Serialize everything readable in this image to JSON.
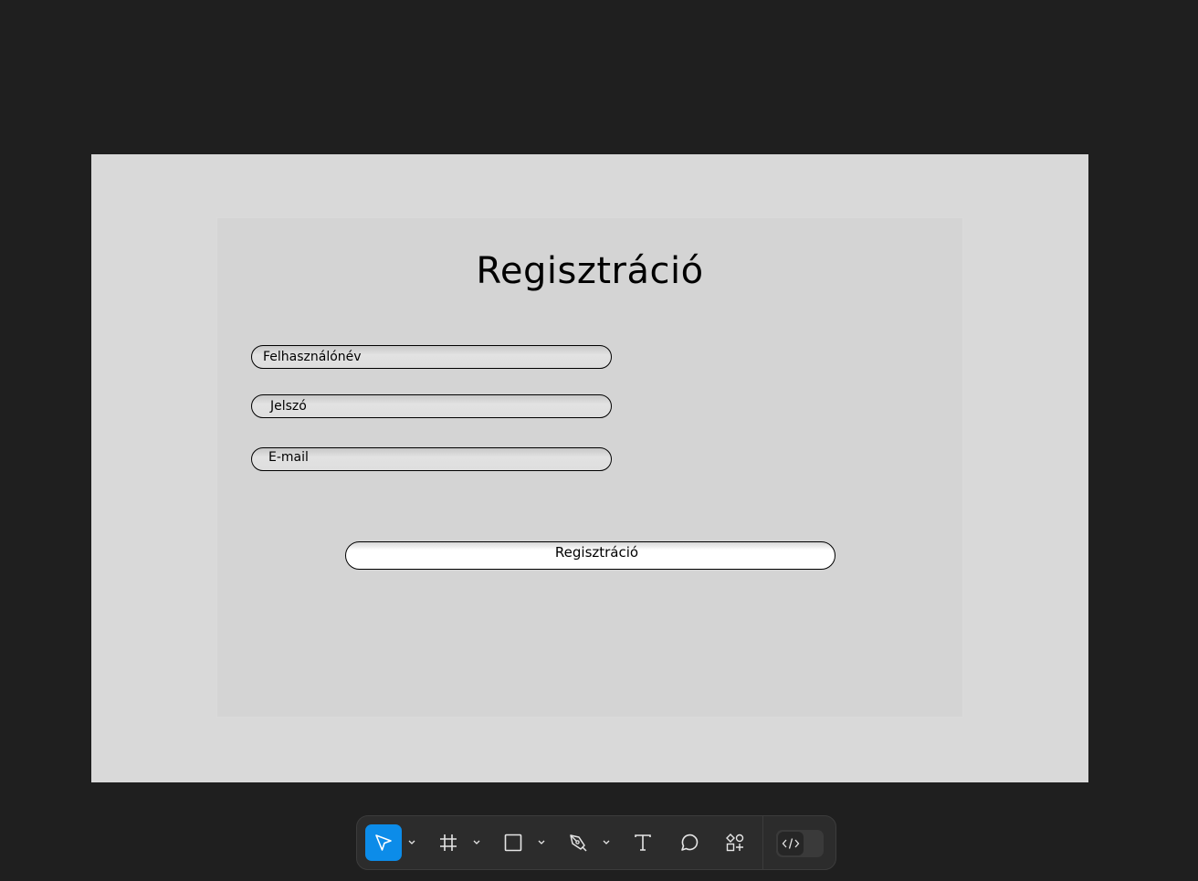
{
  "form": {
    "title": "Regisztráció",
    "fields": {
      "username": "Felhasználónév",
      "password": "Jelszó",
      "email": "E-mail"
    },
    "submit_label": "Regisztráció"
  },
  "toolbar": {
    "tools": [
      {
        "icon": "move-cursor-icon",
        "active": true,
        "has_dropdown": true
      },
      {
        "icon": "frame-hash-icon",
        "active": false,
        "has_dropdown": true
      },
      {
        "icon": "rectangle-icon",
        "active": false,
        "has_dropdown": true
      },
      {
        "icon": "pen-icon",
        "active": false,
        "has_dropdown": true
      },
      {
        "icon": "text-icon",
        "active": false,
        "has_dropdown": false
      },
      {
        "icon": "comment-icon",
        "active": false,
        "has_dropdown": false
      },
      {
        "icon": "actions-icon",
        "active": false,
        "has_dropdown": false
      }
    ],
    "dev_mode_icon": "code-icon",
    "accent_color": "#0c8ce9"
  }
}
